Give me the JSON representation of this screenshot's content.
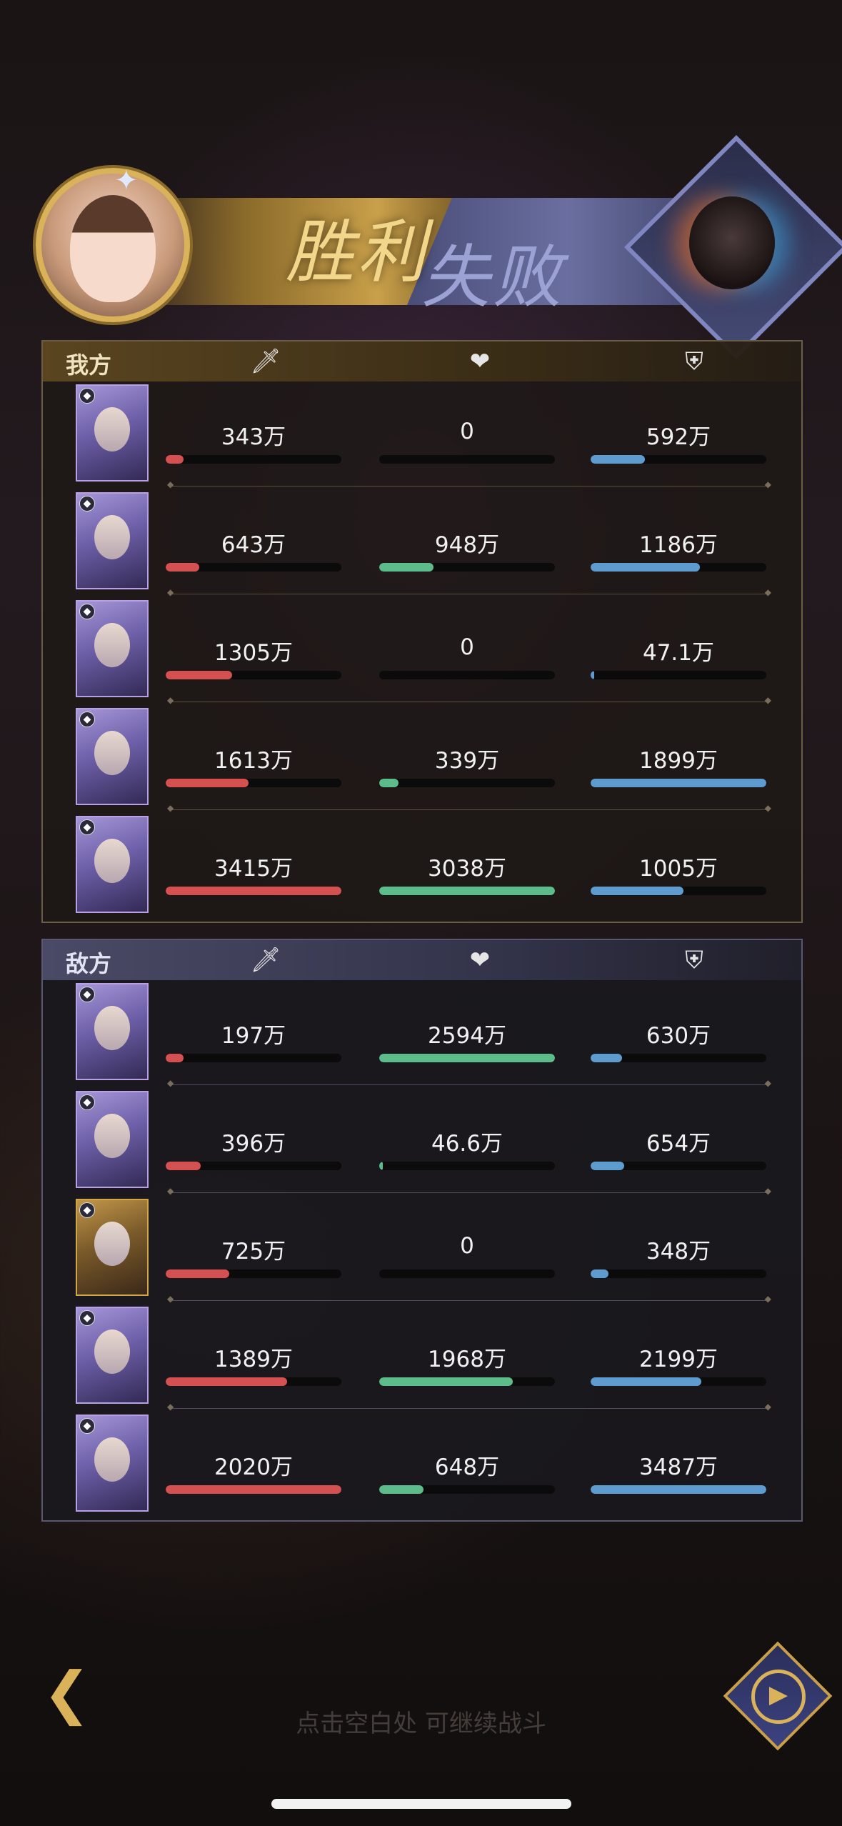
{
  "banner": {
    "win": "胜利",
    "lose": "失败"
  },
  "ally": {
    "title": "我方",
    "rows": [
      {
        "atk": "343万",
        "atk_pct": 10,
        "heal": "0",
        "heal_pct": 0,
        "def": "592万",
        "def_pct": 31
      },
      {
        "atk": "643万",
        "atk_pct": 19,
        "heal": "948万",
        "heal_pct": 31,
        "def": "1186万",
        "def_pct": 62
      },
      {
        "atk": "1305万",
        "atk_pct": 38,
        "heal": "0",
        "heal_pct": 0,
        "def": "47.1万",
        "def_pct": 2
      },
      {
        "atk": "1613万",
        "atk_pct": 47,
        "heal": "339万",
        "heal_pct": 11,
        "def": "1899万",
        "def_pct": 100
      },
      {
        "atk": "3415万",
        "atk_pct": 100,
        "heal": "3038万",
        "heal_pct": 100,
        "def": "1005万",
        "def_pct": 53
      }
    ]
  },
  "enemy": {
    "title": "敌方",
    "rows": [
      {
        "atk": "197万",
        "atk_pct": 10,
        "heal": "2594万",
        "heal_pct": 100,
        "def": "630万",
        "def_pct": 18
      },
      {
        "atk": "396万",
        "atk_pct": 20,
        "heal": "46.6万",
        "heal_pct": 2,
        "def": "654万",
        "def_pct": 19
      },
      {
        "atk": "725万",
        "atk_pct": 36,
        "heal": "0",
        "heal_pct": 0,
        "def": "348万",
        "def_pct": 10
      },
      {
        "atk": "1389万",
        "atk_pct": 69,
        "heal": "1968万",
        "heal_pct": 76,
        "def": "2199万",
        "def_pct": 63
      },
      {
        "atk": "2020万",
        "atk_pct": 100,
        "heal": "648万",
        "heal_pct": 25,
        "def": "3487万",
        "def_pct": 100
      }
    ]
  },
  "icons": {
    "attack": "sword-icon",
    "heal": "heart-icon",
    "defense": "shield-icon",
    "back": "back-arrow-icon",
    "replay": "play-icon"
  },
  "colors": {
    "attack": "#d55050",
    "heal": "#5cbd8a",
    "defense": "#5e9ccf"
  },
  "hint": "点击空白处 可继续战斗"
}
